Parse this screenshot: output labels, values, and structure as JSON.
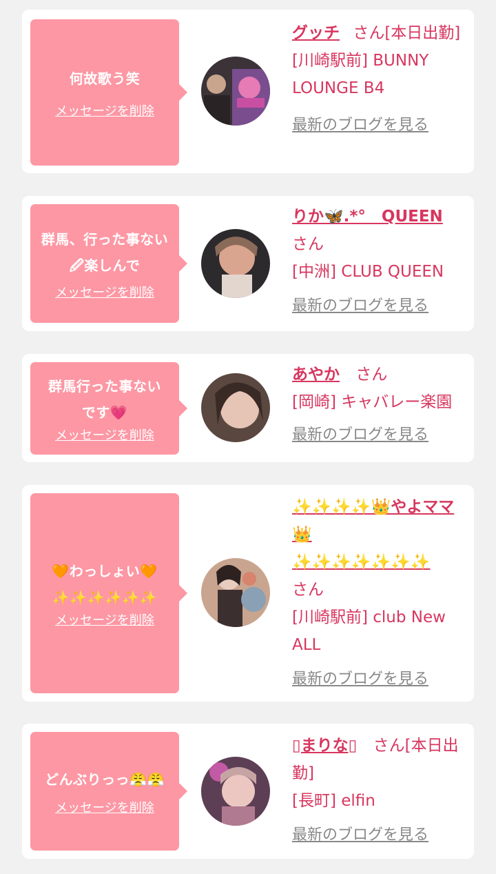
{
  "cards": [
    {
      "message": "何故歌う笑",
      "message2": "",
      "delete_label": "メッセージを削除",
      "name": "グッチ",
      "san": "さん[本日出勤]",
      "shop": "[川崎駅前] BUNNY LOUNGE B4",
      "blog_label": "最新のブログを見る"
    },
    {
      "message": "群馬、行った事ない",
      "message2": "🖉楽しんで",
      "delete_label": "メッセージを削除",
      "name": "りか🦋.*°　QUEEN",
      "san": "さん",
      "shop": "[中洲] CLUB QUEEN",
      "blog_label": "最新のブログを見る"
    },
    {
      "message": "群馬行った事ない",
      "message2": "です💗",
      "delete_label": "メッセージを削除",
      "name": "あやか",
      "san": "さん",
      "shop": "[岡崎] キャバレー楽園",
      "blog_label": "最新のブログを見る"
    },
    {
      "message": "🧡わっしょい🧡",
      "message2": "✨✨✨✨✨✨",
      "delete_label": "メッセージを削除",
      "name": "✨✨✨✨👑やよママ👑",
      "name2": "✨✨✨✨✨✨✨",
      "san": "さん",
      "shop": "[川崎駅前] club New ALL",
      "blog_label": "最新のブログを見る"
    },
    {
      "message": "どんぶりっっ😤😤",
      "message2": "",
      "delete_label": "メッセージを削除",
      "name": "▯まりな▯",
      "san": "さん[本日出勤]",
      "shop": "[長町] elfin",
      "blog_label": "最新のブログを見る"
    }
  ]
}
